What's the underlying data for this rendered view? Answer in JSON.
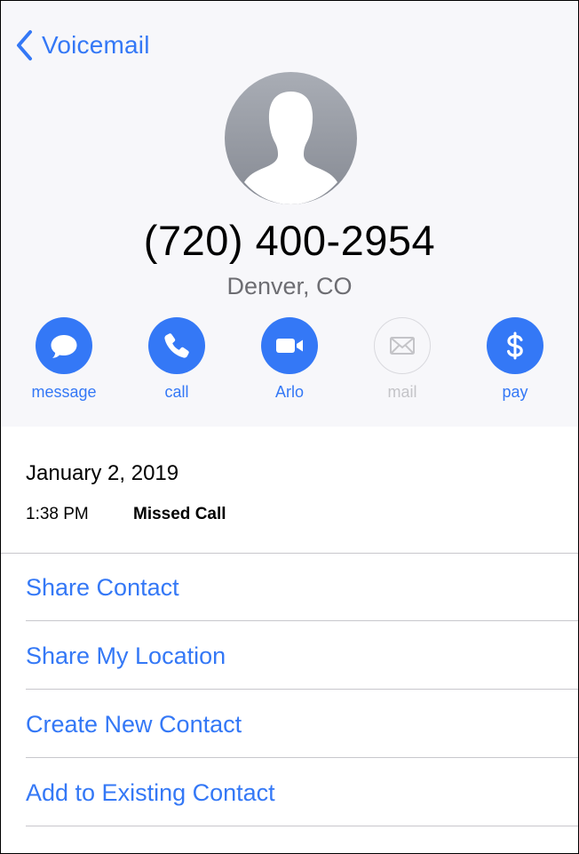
{
  "nav": {
    "back_label": "Voicemail"
  },
  "contact": {
    "phone": "(720) 400-2954",
    "location": "Denver, CO"
  },
  "actions": [
    {
      "label": "message",
      "icon": "message-bubble-icon",
      "enabled": true
    },
    {
      "label": "call",
      "icon": "phone-icon",
      "enabled": true
    },
    {
      "label": "Arlo",
      "icon": "video-camera-icon",
      "enabled": true
    },
    {
      "label": "mail",
      "icon": "envelope-icon",
      "enabled": false
    },
    {
      "label": "pay",
      "icon": "dollar-icon",
      "enabled": true
    }
  ],
  "call_log": {
    "date": "January 2, 2019",
    "time": "1:38 PM",
    "type": "Missed Call"
  },
  "menu": [
    "Share Contact",
    "Share My Location",
    "Create New Contact",
    "Add to Existing Contact"
  ],
  "colors": {
    "accent": "#3478f6",
    "header_bg": "#f7f7fa",
    "secondary_text": "#6d6d72",
    "disabled": "#c4c4c8",
    "separator": "#c8c7cc"
  }
}
